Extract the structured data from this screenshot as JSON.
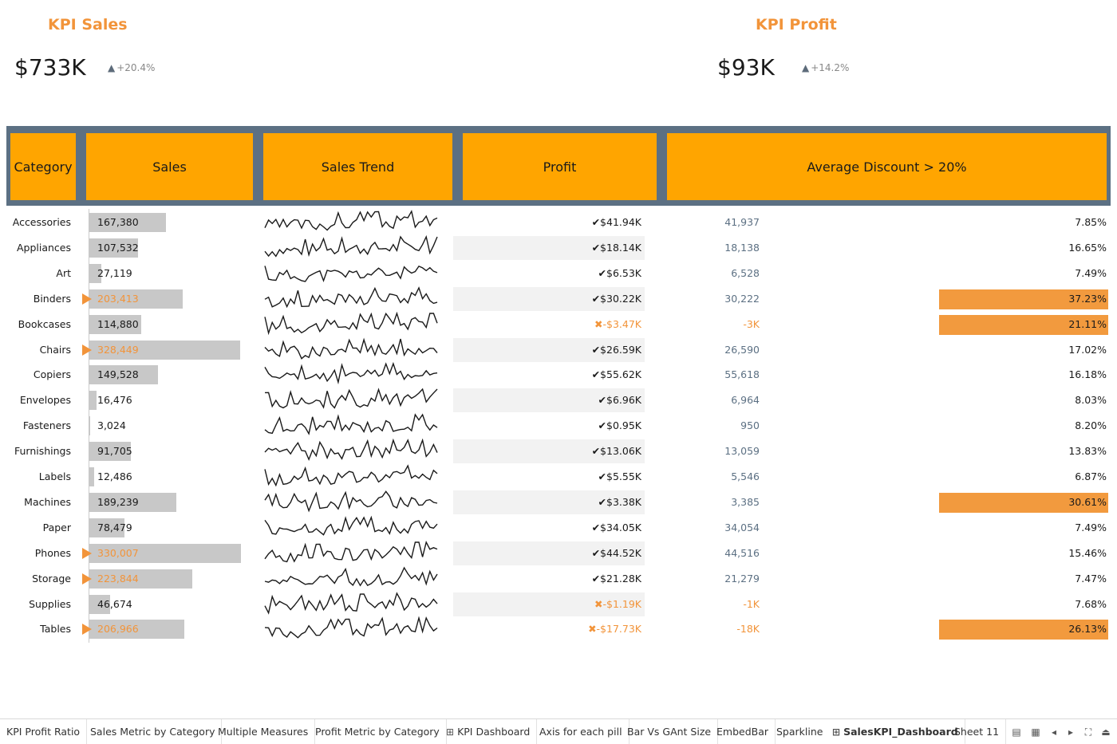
{
  "kpi": {
    "sales": {
      "title": "KPI Sales",
      "value": "$733K",
      "delta": "+20.4%"
    },
    "profit": {
      "title": "KPI Profit",
      "value": "$93K",
      "delta": "+14.2%"
    }
  },
  "table": {
    "headers": [
      "Category",
      "Sales",
      "Sales Trend",
      "Profit",
      "Average Discount > 20%"
    ],
    "rows": [
      {
        "category": "Accessories",
        "sales": "167,380",
        "sales_num": 167380,
        "highlight": false,
        "profit": "✔$41.94K",
        "profit_neg": false,
        "profit_num": "41,937",
        "discount": "7.85%",
        "disc_flag": false
      },
      {
        "category": "Appliances",
        "sales": "107,532",
        "sales_num": 107532,
        "highlight": false,
        "profit": "✔$18.14K",
        "profit_neg": false,
        "profit_num": "18,138",
        "discount": "16.65%",
        "disc_flag": false
      },
      {
        "category": "Art",
        "sales": "27,119",
        "sales_num": 27119,
        "highlight": false,
        "profit": "✔$6.53K",
        "profit_neg": false,
        "profit_num": "6,528",
        "discount": "7.49%",
        "disc_flag": false
      },
      {
        "category": "Binders",
        "sales": "203,413",
        "sales_num": 203413,
        "highlight": true,
        "profit": "✔$30.22K",
        "profit_neg": false,
        "profit_num": "30,222",
        "discount": "37.23%",
        "disc_flag": true
      },
      {
        "category": "Bookcases",
        "sales": "114,880",
        "sales_num": 114880,
        "highlight": false,
        "profit": "✖-$3.47K",
        "profit_neg": true,
        "profit_num": "-3K",
        "discount": "21.11%",
        "disc_flag": true
      },
      {
        "category": "Chairs",
        "sales": "328,449",
        "sales_num": 328449,
        "highlight": true,
        "profit": "✔$26.59K",
        "profit_neg": false,
        "profit_num": "26,590",
        "discount": "17.02%",
        "disc_flag": false
      },
      {
        "category": "Copiers",
        "sales": "149,528",
        "sales_num": 149528,
        "highlight": false,
        "profit": "✔$55.62K",
        "profit_neg": false,
        "profit_num": "55,618",
        "discount": "16.18%",
        "disc_flag": false
      },
      {
        "category": "Envelopes",
        "sales": "16,476",
        "sales_num": 16476,
        "highlight": false,
        "profit": "✔$6.96K",
        "profit_neg": false,
        "profit_num": "6,964",
        "discount": "8.03%",
        "disc_flag": false
      },
      {
        "category": "Fasteners",
        "sales": "3,024",
        "sales_num": 3024,
        "highlight": false,
        "profit": "✔$0.95K",
        "profit_neg": false,
        "profit_num": "950",
        "discount": "8.20%",
        "disc_flag": false
      },
      {
        "category": "Furnishings",
        "sales": "91,705",
        "sales_num": 91705,
        "highlight": false,
        "profit": "✔$13.06K",
        "profit_neg": false,
        "profit_num": "13,059",
        "discount": "13.83%",
        "disc_flag": false
      },
      {
        "category": "Labels",
        "sales": "12,486",
        "sales_num": 12486,
        "highlight": false,
        "profit": "✔$5.55K",
        "profit_neg": false,
        "profit_num": "5,546",
        "discount": "6.87%",
        "disc_flag": false
      },
      {
        "category": "Machines",
        "sales": "189,239",
        "sales_num": 189239,
        "highlight": false,
        "profit": "✔$3.38K",
        "profit_neg": false,
        "profit_num": "3,385",
        "discount": "30.61%",
        "disc_flag": true
      },
      {
        "category": "Paper",
        "sales": "78,479",
        "sales_num": 78479,
        "highlight": false,
        "profit": "✔$34.05K",
        "profit_neg": false,
        "profit_num": "34,054",
        "discount": "7.49%",
        "disc_flag": false
      },
      {
        "category": "Phones",
        "sales": "330,007",
        "sales_num": 330007,
        "highlight": true,
        "profit": "✔$44.52K",
        "profit_neg": false,
        "profit_num": "44,516",
        "discount": "15.46%",
        "disc_flag": false
      },
      {
        "category": "Storage",
        "sales": "223,844",
        "sales_num": 223844,
        "highlight": true,
        "profit": "✔$21.28K",
        "profit_neg": false,
        "profit_num": "21,279",
        "discount": "7.47%",
        "disc_flag": false
      },
      {
        "category": "Supplies",
        "sales": "46,674",
        "sales_num": 46674,
        "highlight": false,
        "profit": "✖-$1.19K",
        "profit_neg": true,
        "profit_num": "-1K",
        "discount": "7.68%",
        "disc_flag": false
      },
      {
        "category": "Tables",
        "sales": "206,966",
        "sales_num": 206966,
        "highlight": true,
        "profit": "✖-$17.73K",
        "profit_neg": true,
        "profit_num": "-18K",
        "discount": "26.13%",
        "disc_flag": true
      }
    ]
  },
  "tabs": [
    {
      "label": "KPI Profit Ratio",
      "icon": false,
      "active": false
    },
    {
      "label": "Sales Metric by Category",
      "icon": false,
      "active": false
    },
    {
      "label": "Multiple Measures",
      "icon": false,
      "active": false
    },
    {
      "label": "Profit Metric by Category",
      "icon": false,
      "active": false
    },
    {
      "label": "KPI Dashboard",
      "icon": true,
      "active": false
    },
    {
      "label": "Axis for each pill",
      "icon": false,
      "active": false
    },
    {
      "label": "Bar Vs GAnt Size",
      "icon": false,
      "active": false
    },
    {
      "label": "EmbedBar",
      "icon": false,
      "active": false
    },
    {
      "label": "Sparkline",
      "icon": false,
      "active": false
    },
    {
      "label": "SalesKPI_Dashboard",
      "icon": true,
      "active": true
    },
    {
      "label": "Sheet 11",
      "icon": false,
      "active": false
    }
  ],
  "controls": [
    "show-sheet-sorter-icon",
    "filmstrip-icon",
    "previous-sheet-icon",
    "next-sheet-icon",
    "fullscreen-icon",
    "present-icon"
  ],
  "colors": {
    "accent": "#f2943a",
    "header": "#ffa500",
    "band": "#5c7083",
    "bar": "#c8c8c8",
    "discount_flag": "#f29a3e"
  }
}
